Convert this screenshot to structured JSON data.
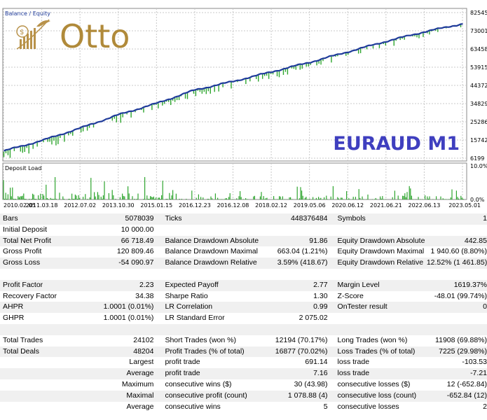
{
  "chart": {
    "legend": "Balance / Equity",
    "watermark": "EURAUD M1",
    "logo_text": "Otto",
    "y_ticks": [
      "82545",
      "73001",
      "63458",
      "53915",
      "44372",
      "34829",
      "25286",
      "15742",
      "6199"
    ],
    "load_title": "Deposit Load",
    "load_ticks": [
      "10.0%",
      "0.0%"
    ],
    "x_ticks": [
      "2010.02.05",
      "2011.03.18",
      "2012.07.02",
      "2013.10.30",
      "2015.01.15",
      "2016.12.23",
      "2016.12.08",
      "2018.02.12",
      "2019.05.06",
      "2020.06.12",
      "2021.06.21",
      "2022.06.13",
      "2023.05.01"
    ],
    "colors": {
      "balance": "#1f3b9a",
      "equity": "#2ea52e",
      "watermark": "#3f3fbf",
      "grid": "#c8c8c8"
    }
  },
  "chart_data": {
    "type": "line",
    "title": "",
    "ylim": [
      6199,
      82545
    ],
    "x": [
      "2010.02.05",
      "2011.03.18",
      "2012.07.02",
      "2013.10.30",
      "2015.01.15",
      "2016.12.23",
      "2016.12.08",
      "2018.02.12",
      "2019.05.06",
      "2020.06.12",
      "2021.06.21",
      "2022.06.13",
      "2023.05.01"
    ],
    "series": [
      {
        "name": "Balance",
        "values": [
          10000,
          15500,
          22000,
          29000,
          35000,
          42000,
          46500,
          51500,
          56500,
          62000,
          67500,
          72500,
          76700
        ]
      }
    ]
  },
  "report": {
    "rows": [
      {
        "shade": true,
        "c": [
          "Bars",
          "5078039",
          "Ticks",
          "448376484",
          "Symbols",
          "1"
        ]
      },
      {
        "shade": false,
        "c": [
          "Initial Deposit",
          "10 000.00",
          "",
          "",
          "",
          ""
        ]
      },
      {
        "shade": true,
        "c": [
          "Total Net Profit",
          "66 718.49",
          "Balance Drawdown Absolute",
          "91.86",
          "Equity Drawdown Absolute",
          "442.85"
        ]
      },
      {
        "shade": false,
        "c": [
          "Gross Profit",
          "120 809.46",
          "Balance Drawdown Maximal",
          "663.04 (1.21%)",
          "Equity Drawdown Maximal",
          "1 940.60 (8.80%)"
        ]
      },
      {
        "shade": true,
        "c": [
          "Gross Loss",
          "-54 090.97",
          "Balance Drawdown Relative",
          "3.59% (418.67)",
          "Equity Drawdown Relative",
          "12.52% (1 461.85)"
        ]
      },
      {
        "shade": false,
        "blank": true,
        "c": [
          "",
          "",
          "",
          "",
          "",
          ""
        ]
      },
      {
        "shade": true,
        "c": [
          "Profit Factor",
          "2.23",
          "Expected Payoff",
          "2.77",
          "Margin Level",
          "1619.37%"
        ]
      },
      {
        "shade": false,
        "c": [
          "Recovery Factor",
          "34.38",
          "Sharpe Ratio",
          "1.30",
          "Z-Score",
          "-48.01 (99.74%)"
        ]
      },
      {
        "shade": true,
        "c": [
          "AHPR",
          "1.0001 (0.01%)",
          "LR Correlation",
          "0.99",
          "OnTester result",
          "0"
        ]
      },
      {
        "shade": false,
        "c": [
          "GHPR",
          "1.0001 (0.01%)",
          "LR Standard Error",
          "2 075.02",
          "",
          ""
        ]
      },
      {
        "shade": true,
        "blank": true,
        "c": [
          "",
          "",
          "",
          "",
          "",
          ""
        ]
      },
      {
        "shade": false,
        "c": [
          "Total Trades",
          "24102",
          "Short Trades (won %)",
          "12194 (70.17%)",
          "Long Trades (won %)",
          "11908 (69.88%)"
        ]
      },
      {
        "shade": true,
        "c": [
          "Total Deals",
          "48204",
          "Profit Trades (% of total)",
          "16877 (70.02%)",
          "Loss Trades (% of total)",
          "7225 (29.98%)"
        ]
      },
      {
        "shade": false,
        "c": [
          "",
          "Largest",
          "profit trade",
          "691.14",
          "loss trade",
          "-103.53"
        ]
      },
      {
        "shade": true,
        "c": [
          "",
          "Average",
          "profit trade",
          "7.16",
          "loss trade",
          "-7.21"
        ]
      },
      {
        "shade": false,
        "c": [
          "",
          "Maximum",
          "consecutive wins ($)",
          "30 (43.98)",
          "consecutive losses ($)",
          "12 (-652.84)"
        ]
      },
      {
        "shade": true,
        "c": [
          "",
          "Maximal",
          "consecutive profit (count)",
          "1 078.88 (4)",
          "consecutive loss (count)",
          "-652.84 (12)"
        ]
      },
      {
        "shade": false,
        "c": [
          "",
          "Average",
          "consecutive wins",
          "5",
          "consecutive losses",
          "2"
        ]
      }
    ]
  }
}
